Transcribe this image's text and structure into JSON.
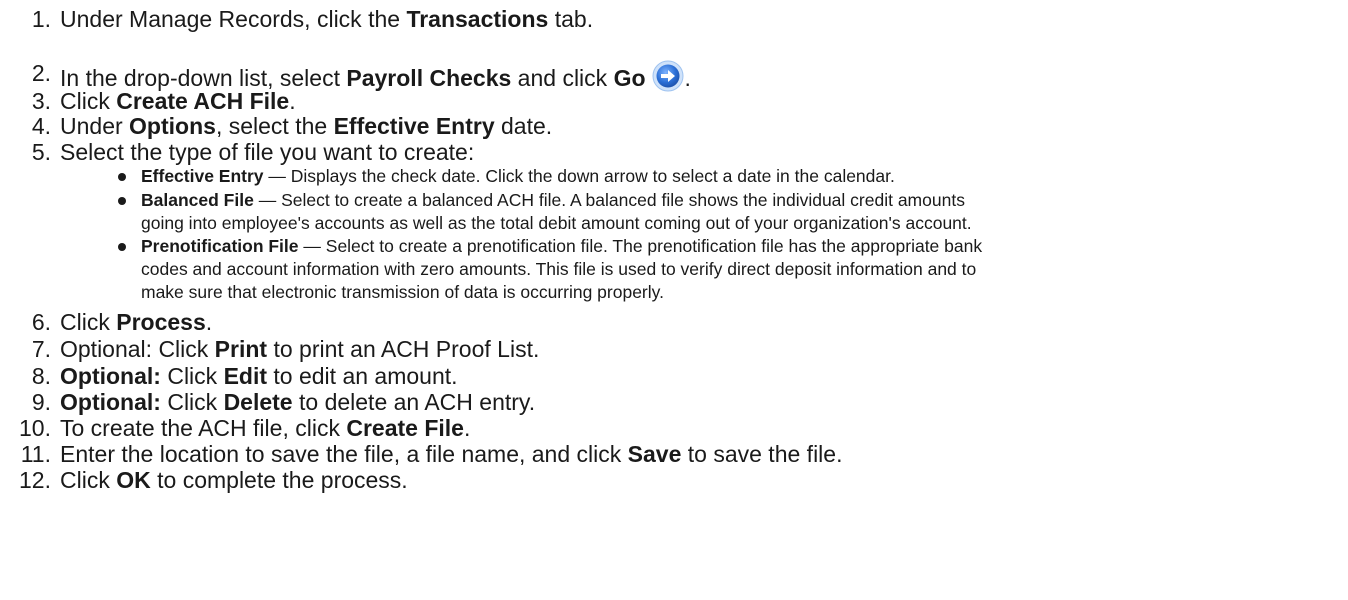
{
  "steps": [
    {
      "number": "1.",
      "parts": [
        "Under Manage Records, click the ",
        "Transactions",
        " tab."
      ]
    },
    {
      "number": "2.",
      "parts": [
        "In the drop-down list, select ",
        "Payroll Checks",
        " and click ",
        "Go",
        "."
      ]
    },
    {
      "number": "3.",
      "parts": [
        "Click ",
        "Create ACH File",
        "."
      ]
    },
    {
      "number": "4.",
      "parts": [
        "Under ",
        "Options",
        ", select the ",
        "Effective Entry",
        " date."
      ]
    },
    {
      "number": "5.",
      "parts": [
        "Select the type of file you want to create:"
      ]
    },
    {
      "number": "6.",
      "parts": [
        "Click ",
        "Process",
        "."
      ]
    },
    {
      "number": "7.",
      "parts": [
        "Optional: Click ",
        "Print",
        " to print an ACH Proof List."
      ]
    },
    {
      "number": "8.",
      "parts": [
        "Optional:",
        " Click ",
        "Edit",
        " to edit an amount."
      ]
    },
    {
      "number": "9.",
      "parts": [
        "Optional:",
        " Click ",
        "Delete",
        " to delete an ACH entry."
      ]
    },
    {
      "number": "10.",
      "parts": [
        "To create the ACH file, click ",
        "Create File",
        "."
      ]
    },
    {
      "number": "11.",
      "parts": [
        "Enter the location to save the file, a file name, and click ",
        "Save",
        " to save the file."
      ]
    },
    {
      "number": "12.",
      "parts": [
        "Click ",
        "OK",
        " to complete the process."
      ]
    }
  ],
  "file_types": [
    {
      "term": "Effective Entry",
      "lines": [
        "— Displays the check date. Click the down arrow to select a date in the calendar."
      ]
    },
    {
      "term": "Balanced File",
      "lines": [
        "— Select to create a balanced ACH file. A balanced file shows the individual credit amounts",
        "going into employee's accounts as well as the total debit amount coming out of your organization's account."
      ]
    },
    {
      "term": "Prenotification File",
      "lines": [
        "— Select to create a prenotification file. The prenotification file has the appropriate bank",
        "codes and account information with zero amounts. This file is used to verify direct deposit information and to",
        "make sure that electronic transmission of data is occurring properly."
      ]
    }
  ],
  "icons": {
    "go": "go-arrow-icon"
  },
  "colors": {
    "go_icon_fill": "#2b6fd6",
    "go_icon_ring": "#9fc3f0"
  }
}
